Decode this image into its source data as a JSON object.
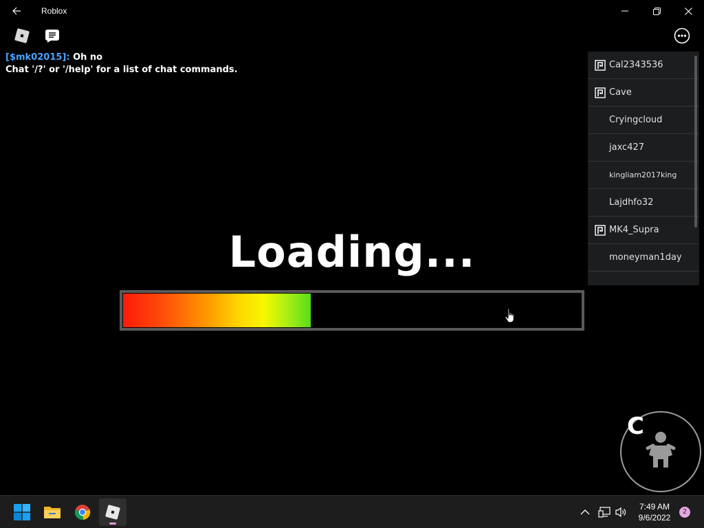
{
  "window": {
    "title": "Roblox"
  },
  "chat": {
    "messages": [
      {
        "name": "[$mk02015]:",
        "text": "Oh no"
      }
    ],
    "system": "Chat '/?' or '/help' for a list of chat commands."
  },
  "players": [
    {
      "name": "Cal2343536",
      "premium": true
    },
    {
      "name": "Cave",
      "premium": true
    },
    {
      "name": "Cryingcloud",
      "premium": false
    },
    {
      "name": "jaxc427",
      "premium": false
    },
    {
      "name": "kingliam2017king",
      "premium": false
    },
    {
      "name": "Lajdhfo32",
      "premium": false
    },
    {
      "name": "MK4_Supra",
      "premium": true
    },
    {
      "name": "moneyman1day",
      "premium": false
    }
  ],
  "loading": {
    "text": "Loading...",
    "progress": 0.41
  },
  "crouch_button": {
    "key": "C",
    "icon": "crouch-icon"
  },
  "taskbar": {
    "apps": [
      "start-icon",
      "file-explorer-icon",
      "chrome-icon",
      "roblox-icon"
    ],
    "clock": {
      "time": "7:49 AM",
      "date": "9/6/2022"
    },
    "notification_count": "2"
  },
  "colors": {
    "chat_name": "#4aa3ff",
    "playerlist_bg": "#1b1d1f",
    "bar_border": "#5a5a5a",
    "notification_badge": "#e6a6e0"
  }
}
